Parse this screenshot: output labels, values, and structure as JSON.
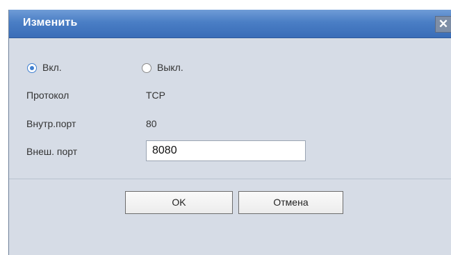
{
  "dialog": {
    "title": "Изменить",
    "close_glyph": "✕"
  },
  "status": {
    "options": [
      {
        "label": "Вкл.",
        "checked": true
      },
      {
        "label": "Выкл.",
        "checked": false
      }
    ]
  },
  "fields": {
    "protocol_label": "Протокол",
    "protocol_value": "TCP",
    "internal_port_label": "Внутр.порт",
    "internal_port_value": "80",
    "external_port_label": "Внеш. порт",
    "external_port_value": "8080"
  },
  "buttons": {
    "ok_label": "OK",
    "cancel_label": "Отмена"
  },
  "colors": {
    "titlebar": "#4a7ec5",
    "panel": "#d6dce6",
    "radio_accent": "#3f7fd0"
  },
  "icons": {
    "close": "close-icon"
  }
}
